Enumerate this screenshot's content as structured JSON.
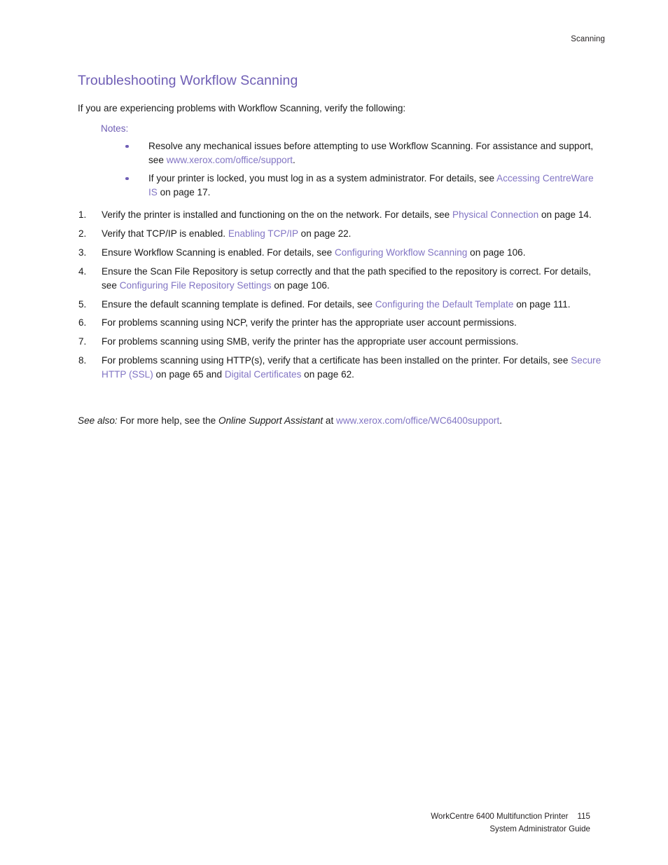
{
  "document": {
    "running_header": "Scanning",
    "colors": {
      "heading_purple": "#6f5eb5",
      "link_purple": "#8275c4",
      "body_black": "#1a1a1a",
      "page_background": "#ffffff"
    }
  },
  "section": {
    "title": "Troubleshooting Workflow Scanning",
    "intro": "If you are experiencing problems with Workflow Scanning, verify the following:",
    "notes_label": "Notes:"
  },
  "notes": [
    {
      "parts": [
        {
          "type": "text",
          "text": "Resolve any mechanical issues before attempting to use Workflow Scanning. For assistance and support, see "
        },
        {
          "type": "link",
          "text": "www.xerox.com/office/support"
        },
        {
          "type": "text",
          "text": "."
        }
      ]
    },
    {
      "parts": [
        {
          "type": "text",
          "text": "If your printer is locked, you must log in as a system administrator. For details, see "
        },
        {
          "type": "link",
          "text": "Accessing CentreWare IS"
        },
        {
          "type": "text",
          "text": " on page 17."
        }
      ]
    }
  ],
  "steps": [
    {
      "number": "1.",
      "parts": [
        {
          "type": "text",
          "text": "Verify the printer is installed and functioning on the on the network. For details, see "
        },
        {
          "type": "link",
          "text": "Physical Connection"
        },
        {
          "type": "text",
          "text": " on page 14."
        }
      ]
    },
    {
      "number": "2.",
      "parts": [
        {
          "type": "text",
          "text": "Verify that TCP/IP is enabled. "
        },
        {
          "type": "link",
          "text": "Enabling TCP/IP"
        },
        {
          "type": "text",
          "text": " on page 22."
        }
      ]
    },
    {
      "number": "3.",
      "parts": [
        {
          "type": "text",
          "text": "Ensure Workflow Scanning is enabled. For details, see "
        },
        {
          "type": "link",
          "text": "Configuring Workflow Scanning"
        },
        {
          "type": "text",
          "text": " on page 106."
        }
      ]
    },
    {
      "number": "4.",
      "parts": [
        {
          "type": "text",
          "text": "Ensure the Scan File Repository is setup correctly and that the path specified to the repository is correct. For details, see "
        },
        {
          "type": "link",
          "text": "Configuring File Repository Settings"
        },
        {
          "type": "text",
          "text": " on page 106."
        }
      ]
    },
    {
      "number": "5.",
      "parts": [
        {
          "type": "text",
          "text": "Ensure the default scanning template is defined. For details, see "
        },
        {
          "type": "link",
          "text": "Configuring the Default Template"
        },
        {
          "type": "text",
          "text": " on page 111."
        }
      ]
    },
    {
      "number": "6.",
      "parts": [
        {
          "type": "text",
          "text": "For problems scanning using NCP, verify the printer has the appropriate user account permissions."
        }
      ]
    },
    {
      "number": "7.",
      "parts": [
        {
          "type": "text",
          "text": "For problems scanning using SMB, verify the printer has the appropriate user account permissions."
        }
      ]
    },
    {
      "number": "8.",
      "parts": [
        {
          "type": "text",
          "text": "For problems scanning using HTTP(s), verify that a certificate has been installed on the printer. For details, see "
        },
        {
          "type": "link",
          "text": "Secure HTTP (SSL)"
        },
        {
          "type": "text",
          "text": " on page 65 and "
        },
        {
          "type": "link",
          "text": "Digital Certificates"
        },
        {
          "type": "text",
          "text": " on page 62."
        }
      ]
    }
  ],
  "see_also": {
    "parts": [
      {
        "type": "italic",
        "text": "See also:"
      },
      {
        "type": "text",
        "text": " For more help, see the "
      },
      {
        "type": "italic",
        "text": "Online Support Assistant"
      },
      {
        "type": "text",
        "text": " at "
      },
      {
        "type": "link",
        "text": "www.xerox.com/office/WC6400support"
      },
      {
        "type": "text",
        "text": "."
      }
    ]
  },
  "footer": {
    "product_line": "WorkCentre 6400 Multifunction Printer",
    "page_number": "115",
    "guide_line": "System Administrator Guide"
  }
}
